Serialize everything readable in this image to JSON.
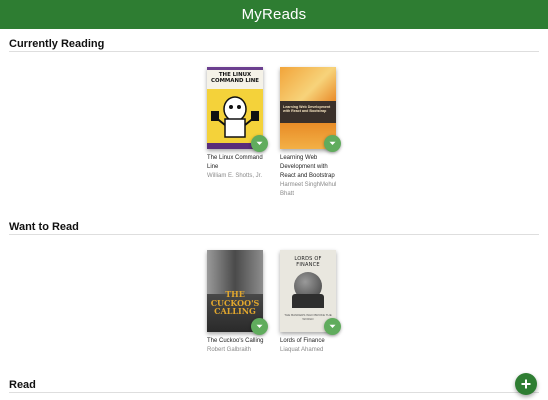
{
  "header": {
    "title": "MyReads"
  },
  "shelves": [
    {
      "title": "Currently Reading",
      "books": [
        {
          "title": "The Linux Command Line",
          "authors": "William E. Shotts, Jr.",
          "cover_text": "THE LINUX COMMAND LINE"
        },
        {
          "title": "Learning Web Development with React and Bootstrap",
          "authors": "Harmeet SinghMehul Bhatt",
          "cover_text": "Learning Web Development with React and Bootstrap"
        }
      ]
    },
    {
      "title": "Want to Read",
      "books": [
        {
          "title": "The Cuckoo's Calling",
          "authors": "Robert Galbraith",
          "cover_text": "THE CUCKOO'S CALLING"
        },
        {
          "title": "Lords of Finance",
          "authors": "Liaquat Ahamed",
          "cover_text": "LORDS OF FINANCE",
          "cover_subtext": "THE BANKERS WHO BROKE THE WORLD"
        }
      ]
    },
    {
      "title": "Read",
      "books": []
    }
  ],
  "icons": {
    "shelf_changer": "chevron-down-icon",
    "add": "plus-icon"
  },
  "colors": {
    "header": "#2e7d32",
    "changer": "#60ac5d",
    "fab": "#2e7d32",
    "author": "#8a8a8a"
  }
}
